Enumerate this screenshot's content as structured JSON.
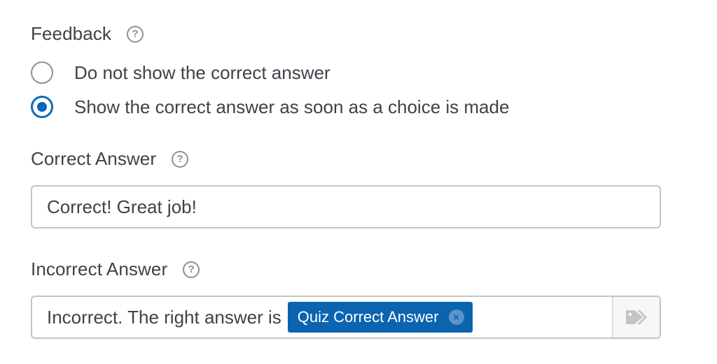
{
  "feedback": {
    "label": "Feedback",
    "help_icon": "question-circle-icon",
    "options": [
      {
        "label": "Do not show the correct answer",
        "checked": false
      },
      {
        "label": "Show the correct answer as soon as a choice is made",
        "checked": true
      }
    ]
  },
  "correct_answer": {
    "label": "Correct Answer",
    "help_icon": "question-circle-icon",
    "value": "Correct! Great job!"
  },
  "incorrect_answer": {
    "label": "Incorrect Answer",
    "help_icon": "question-circle-icon",
    "value": "Incorrect. The right answer is",
    "tag": {
      "label": "Quiz Correct Answer",
      "remove_icon": "close-icon"
    },
    "tags_button_icon": "tags-icon"
  },
  "colors": {
    "accent": "#0b64b0",
    "text": "#3c434a",
    "border": "#c3c4c7",
    "muted_icon": "#8c8f94"
  }
}
